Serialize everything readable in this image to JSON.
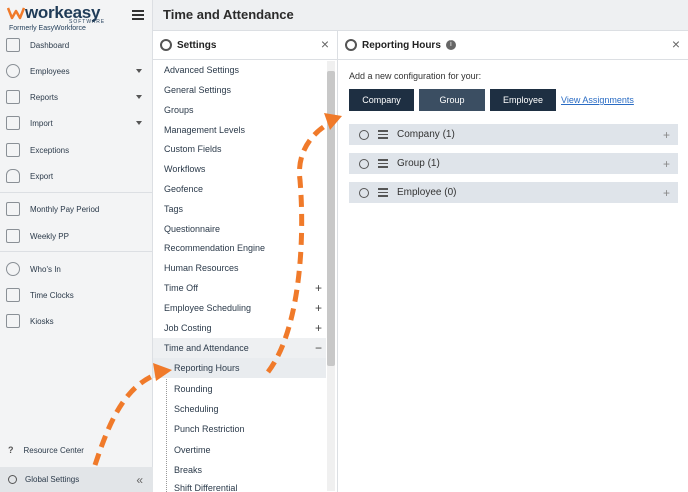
{
  "brand": {
    "name": "workeasy",
    "tag": "SOFTWARE",
    "formerly": "Formerly EasyWorkforce"
  },
  "nav": {
    "items": [
      {
        "label": "Dashboard"
      },
      {
        "label": "Employees"
      },
      {
        "label": "Reports"
      },
      {
        "label": "Import"
      },
      {
        "label": "Exceptions"
      },
      {
        "label": "Export"
      },
      {
        "label": "Monthly Pay Period"
      },
      {
        "label": "Weekly PP"
      },
      {
        "label": "Who's In"
      },
      {
        "label": "Time Clocks"
      },
      {
        "label": "Kiosks"
      }
    ],
    "resource_center": "Resource Center",
    "global_settings": "Global Settings",
    "collapse": "«"
  },
  "header": {
    "title": "Time and Attendance"
  },
  "settings": {
    "title": "Settings",
    "close": "×",
    "items": [
      {
        "label": "Advanced Settings"
      },
      {
        "label": "General Settings"
      },
      {
        "label": "Groups"
      },
      {
        "label": "Management Levels"
      },
      {
        "label": "Custom Fields"
      },
      {
        "label": "Workflows"
      },
      {
        "label": "Geofence"
      },
      {
        "label": "Tags"
      },
      {
        "label": "Questionnaire"
      },
      {
        "label": "Recommendation Engine"
      },
      {
        "label": "Human Resources"
      },
      {
        "label": "Time Off",
        "expander": "+"
      },
      {
        "label": "Employee Scheduling",
        "expander": "+"
      },
      {
        "label": "Job Costing",
        "expander": "+"
      },
      {
        "label": "Time and Attendance",
        "expander": "−"
      }
    ],
    "subitems": [
      {
        "label": "Reporting Hours"
      },
      {
        "label": "Rounding"
      },
      {
        "label": "Scheduling"
      },
      {
        "label": "Punch Restriction"
      },
      {
        "label": "Overtime"
      },
      {
        "label": "Breaks"
      },
      {
        "label": "Shift Differential"
      }
    ]
  },
  "reporting_hours": {
    "title": "Reporting Hours",
    "info": "i",
    "close": "×",
    "add_text": "Add a new configuration for your:",
    "buttons": {
      "company": "Company",
      "group": "Group",
      "employee": "Employee"
    },
    "view_assignments": "View Assignments",
    "rows": [
      {
        "label": "Company (1)",
        "add": "+"
      },
      {
        "label": "Group (1)",
        "add": "+"
      },
      {
        "label": "Employee (0)",
        "add": "+"
      }
    ]
  },
  "colors": {
    "dark_button": "#1e2f42",
    "selected_button": "#3b4e62",
    "annotation": "#f07a2a",
    "link": "#2a6cc4"
  }
}
